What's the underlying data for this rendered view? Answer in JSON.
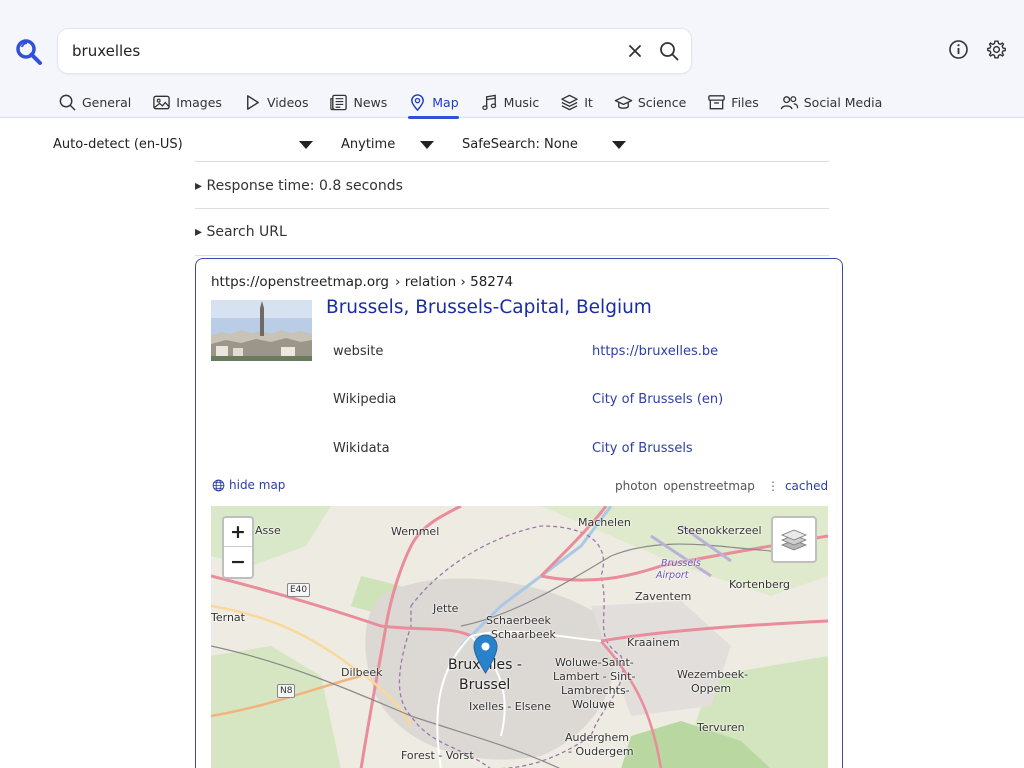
{
  "search": {
    "query": "bruxelles"
  },
  "categories": [
    {
      "label": "General",
      "icon": "search-icon"
    },
    {
      "label": "Images",
      "icon": "image-icon"
    },
    {
      "label": "Videos",
      "icon": "play-icon"
    },
    {
      "label": "News",
      "icon": "newspaper-icon"
    },
    {
      "label": "Map",
      "icon": "map-pin-icon",
      "active": true
    },
    {
      "label": "Music",
      "icon": "music-note-icon"
    },
    {
      "label": "It",
      "icon": "layers-icon"
    },
    {
      "label": "Science",
      "icon": "graduation-cap-icon"
    },
    {
      "label": "Files",
      "icon": "archive-icon"
    },
    {
      "label": "Social Media",
      "icon": "people-icon"
    }
  ],
  "filters": {
    "language": "Auto-detect (en-US)",
    "time": "Anytime",
    "safesearch": "SafeSearch: None"
  },
  "details": {
    "response_time": "▸ Response time: 0.8 seconds",
    "search_url": "▸ Search URL"
  },
  "result": {
    "url": "https://openstreetmap.org",
    "breadcrumb": "› relation › 58274",
    "title": "Brussels, Brussels-Capital, Belgium",
    "attributes": [
      {
        "label": "website",
        "value": "https://bruxelles.be"
      },
      {
        "label": "Wikipedia",
        "value": "City of Brussels (en)"
      },
      {
        "label": "Wikidata",
        "value": "City of Brussels"
      }
    ],
    "hide_map": "hide map",
    "engines": [
      "photon",
      "openstreetmap"
    ],
    "cached": "cached"
  },
  "map": {
    "zoom_in": "+",
    "zoom_out": "−",
    "labels": [
      "Asse",
      "Wemmel",
      "Machelen",
      "Steenokkerzeel",
      "Brussels",
      "Airport",
      "Kortenberg",
      "Zaventem",
      "Ternat",
      "Jette",
      "Schaerbeek",
      "Schaarbeek",
      "Kraainem",
      "Dilbeek",
      "Bruxelles -",
      "Brussel",
      "Woluwe-Saint-",
      "Lambert - Sint-",
      "Lambrechts-",
      "Woluwe",
      "Wezembeek-",
      "Oppem",
      "Ixelles - Elsene",
      "Tervuren",
      "Auderghem",
      "- Oudergem",
      "Forest - Vorst"
    ],
    "shields": [
      "E40",
      "N8"
    ]
  },
  "colors": {
    "accent": "#3050d8",
    "link": "#1a2ba8",
    "card_border": "#3b4aa8",
    "marker": "#2a81cb"
  }
}
